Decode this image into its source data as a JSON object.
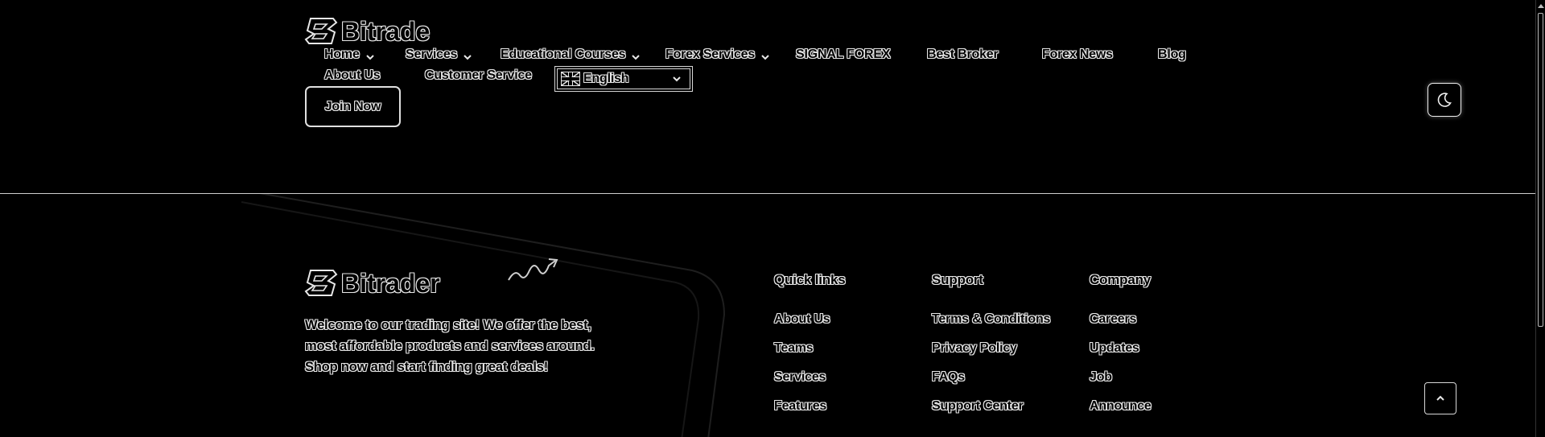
{
  "header": {
    "logo_text": "Bitrade",
    "nav": [
      {
        "label": "Home",
        "has_dropdown": true
      },
      {
        "label": "Services",
        "has_dropdown": true
      },
      {
        "label": "Educational Courses",
        "has_dropdown": true
      },
      {
        "label": "Forex Services",
        "has_dropdown": true
      },
      {
        "label": "SIGNAL FOREX",
        "has_dropdown": false
      },
      {
        "label": "Best Broker",
        "has_dropdown": false
      },
      {
        "label": "Forex News",
        "has_dropdown": false
      },
      {
        "label": "Blog",
        "has_dropdown": false
      },
      {
        "label": "About Us",
        "has_dropdown": false
      },
      {
        "label": "Customer Service",
        "has_dropdown": false
      }
    ],
    "language": {
      "selected": "English",
      "flag": "uk-flag-icon"
    },
    "join_label": "Join Now",
    "theme_icon": "moon-icon"
  },
  "footer": {
    "logo_text": "Bitrader",
    "tagline": "Welcome to our trading site! We offer the best, most affordable products and services around. Shop now and start finding great deals!",
    "columns": [
      {
        "heading": "Quick links",
        "links": [
          "About Us",
          "Teams",
          "Services",
          "Features"
        ]
      },
      {
        "heading": "Support",
        "links": [
          "Terms & Conditions",
          "Privacy Policy",
          "FAQs",
          "Support Center"
        ]
      },
      {
        "heading": "Company",
        "links": [
          "Careers",
          "Updates",
          "Job",
          "Announce"
        ]
      }
    ],
    "scroll_top_icon": "chevron-up-icon"
  },
  "colors": {
    "background": "#000000",
    "outline": "#e8e8e8"
  }
}
